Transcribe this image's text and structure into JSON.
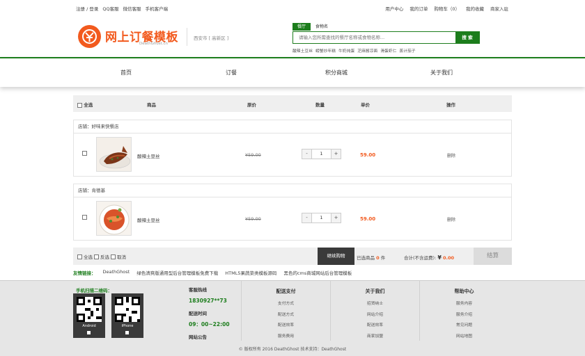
{
  "topbar": {
    "register": "注册",
    "sep": "/",
    "login": "登录",
    "qq": "QQ客服",
    "wechat": "微信客服",
    "mobile": "手机客户端",
    "user_center": "用户中心",
    "my_orders": "我的订单",
    "cart": "购物车（0）",
    "favorites": "我的收藏",
    "merchant": "商家入驻"
  },
  "logo": {
    "title": "网上订餐模板",
    "subtitle": "DeathGhost.cn"
  },
  "city": "西安市 [ 高新区 ]",
  "search": {
    "tabs": [
      "餐厅",
      "食物名"
    ],
    "placeholder": "请输入您所需查找的餐厅名称或食物名称...",
    "button": "搜 索",
    "hot": [
      "酸辣土豆丝",
      "螃蟹炒年糕",
      "牛奶炖蛋",
      "芝麻酱凉面",
      "滑蛋虾仁",
      "蒸计茄子"
    ]
  },
  "nav": [
    "首页",
    "订餐",
    "积分商城",
    "关于我们"
  ],
  "cart": {
    "headers": {
      "select_all": "全选",
      "product": "商品",
      "orig_price": "原价",
      "quantity": "数量",
      "unit_price": "单价",
      "action": "操作"
    },
    "shops": [
      {
        "shop": "店铺：好味来快餐店",
        "name": "酸辣土豆丝",
        "orig_price": "¥59.00",
        "minus": "-",
        "qty": "1",
        "plus": "+",
        "price": "59.00",
        "action": "删除"
      },
      {
        "shop": "店铺：肯德基",
        "name": "酸辣土豆丝",
        "orig_price": "¥59.00",
        "minus": "-",
        "qty": "1",
        "plus": "+",
        "price": "59.00",
        "action": "删除"
      }
    ],
    "footer": {
      "select_all": "全选",
      "invert": "反选",
      "cancel": "取消",
      "continue": "继续购物",
      "selected_prefix": "已选商品",
      "selected_count": "0",
      "selected_suffix": "件",
      "total_label": "合计(不含运费):",
      "yen": "¥",
      "total": "0.00",
      "checkout": "结算"
    }
  },
  "links": {
    "title": "友情链接：",
    "items": [
      "DeathGhost",
      "绿色清爽版通用型后台管理模板免费下载",
      "HTML5果蔬菜类模板源码",
      "黑色的cms商城网站后台管理模板"
    ]
  },
  "footer": {
    "qr_title": "手机扫描二维码：",
    "qr_labels": [
      "Android",
      "iPhone"
    ],
    "hotline_label": "客服热线",
    "hotline": "1830927**73",
    "hours_label": "配送时间",
    "hours": "09：00~22:00",
    "notice": "网站公告",
    "columns": [
      {
        "title": "配送支付",
        "items": [
          "支付方式",
          "配送方式",
          "配送效率",
          "服务费用"
        ]
      },
      {
        "title": "关于我们",
        "items": [
          "招贤纳士",
          "网站介绍",
          "配送效率",
          "商家加盟"
        ]
      },
      {
        "title": "帮助中心",
        "items": [
          "服务内容",
          "服务介绍",
          "常见问题",
          "网站地图"
        ]
      }
    ],
    "copyright": "© 版权所有 2016 DeathGhost 技术支持：DeathGhost"
  },
  "colors": {
    "brand_green": "#1c7d1c",
    "accent_orange": "#f25a1e"
  }
}
